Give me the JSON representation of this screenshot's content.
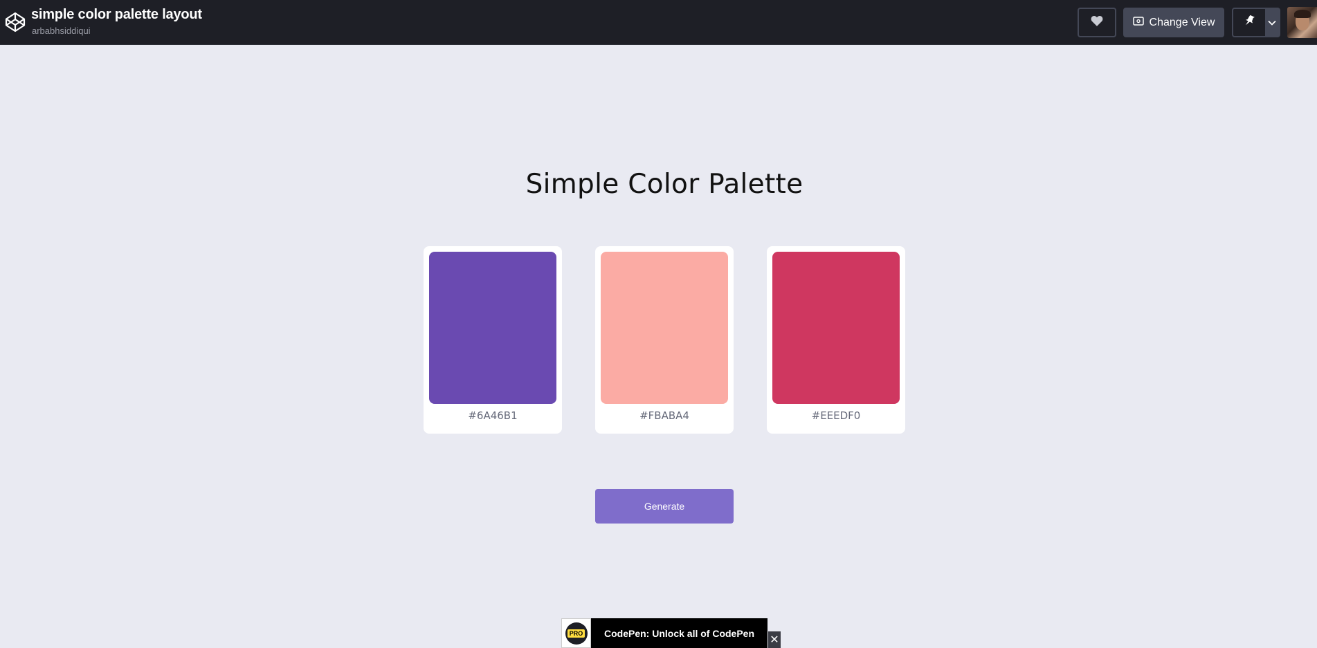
{
  "header": {
    "title": "simple color palette layout",
    "author": "arbabhsiddiqui",
    "change_view_label": "Change View"
  },
  "main": {
    "title": "Simple Color Palette",
    "swatches": [
      {
        "hex": "#6A46B1",
        "color": "#6a4ab1"
      },
      {
        "hex": "#FBABA4",
        "color": "#fbaba4"
      },
      {
        "hex": "#EEEDF0",
        "color": "#cf3760"
      }
    ],
    "generate_label": "Generate"
  },
  "banner": {
    "badge": "PRO",
    "message": "CodePen: Unlock all of CodePen",
    "close": "✕"
  },
  "colors": {
    "topbar_bg": "#1e1f26",
    "page_bg": "#e9eaf2",
    "button_accent": "#7f6dcb"
  }
}
